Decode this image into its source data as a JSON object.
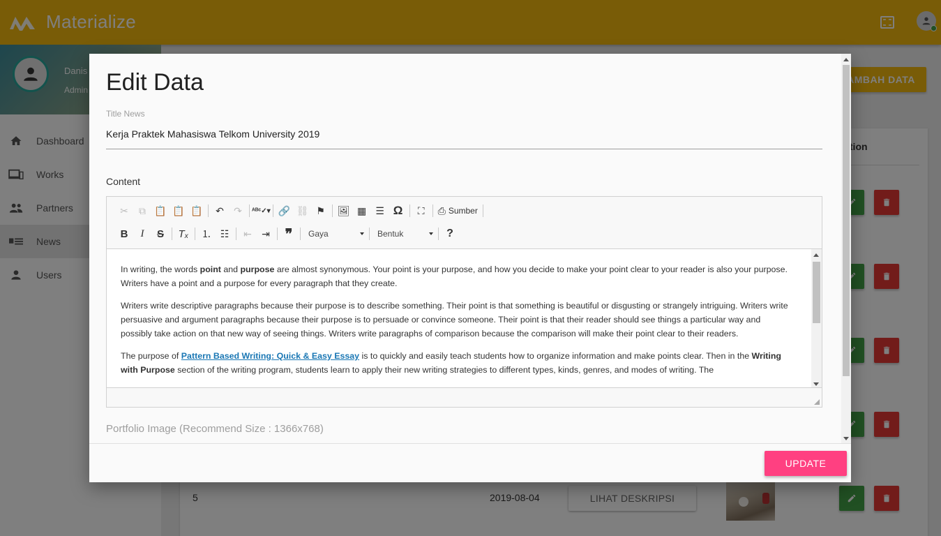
{
  "app": {
    "title": "Materialize"
  },
  "sidebar": {
    "user": {
      "name": "Danis",
      "role": "Admin"
    },
    "items": [
      {
        "label": "Dashboard",
        "icon": "home-icon"
      },
      {
        "label": "Works",
        "icon": "devices-icon"
      },
      {
        "label": "Partners",
        "icon": "group-icon"
      },
      {
        "label": "News",
        "icon": "news-icon",
        "active": true
      },
      {
        "label": "Users",
        "icon": "person-icon"
      }
    ]
  },
  "page": {
    "add_button": "TAMBAH DATA",
    "action_header": "Action",
    "last_row": {
      "no": "5",
      "date": "2019-08-04",
      "desc_button": "LIHAT DESKRIPSI"
    }
  },
  "modal": {
    "title": "Edit Data",
    "title_label": "Title News",
    "title_value": "Kerja Praktek Mahasiswa Telkom University 2019",
    "content_label": "Content",
    "toolbar": {
      "source_label": "Sumber",
      "style_combo": "Gaya",
      "format_combo": "Bentuk"
    },
    "content": {
      "p1": {
        "t1": "In writing, the words ",
        "b1": "point",
        "t2": " and ",
        "b2": "purpose",
        "t3": " are almost synonymous. Your point is your purpose, and how you decide to make your point clear to your reader is also your purpose. Writers have a point and a purpose for every paragraph that they create."
      },
      "p2": "Writers write descriptive paragraphs because their purpose is to describe something. Their point is that something is beautiful or disgusting or strangely intriguing. Writers write persuasive and argument paragraphs because their purpose is to persuade or convince someone. Their point is that their reader should see things a particular way and possibly take action on that new way of seeing things. Writers write paragraphs of comparison because the comparison will make their point clear to their readers.",
      "p3": {
        "t1": "The purpose of ",
        "link": "Pattern Based Writing: Quick & Easy Essay",
        "t2": " is to quickly and easily teach students how to organize information and make points clear. Then in the ",
        "b1": "Writing with Purpose",
        "t3": " section of the writing program, students learn to apply their new writing strategies to different types, kinds, genres, and modes of writing. The"
      }
    },
    "portfolio_label": "Portfolio Image (Recommend Size : 1366x768)",
    "update_button": "UPDATE"
  }
}
